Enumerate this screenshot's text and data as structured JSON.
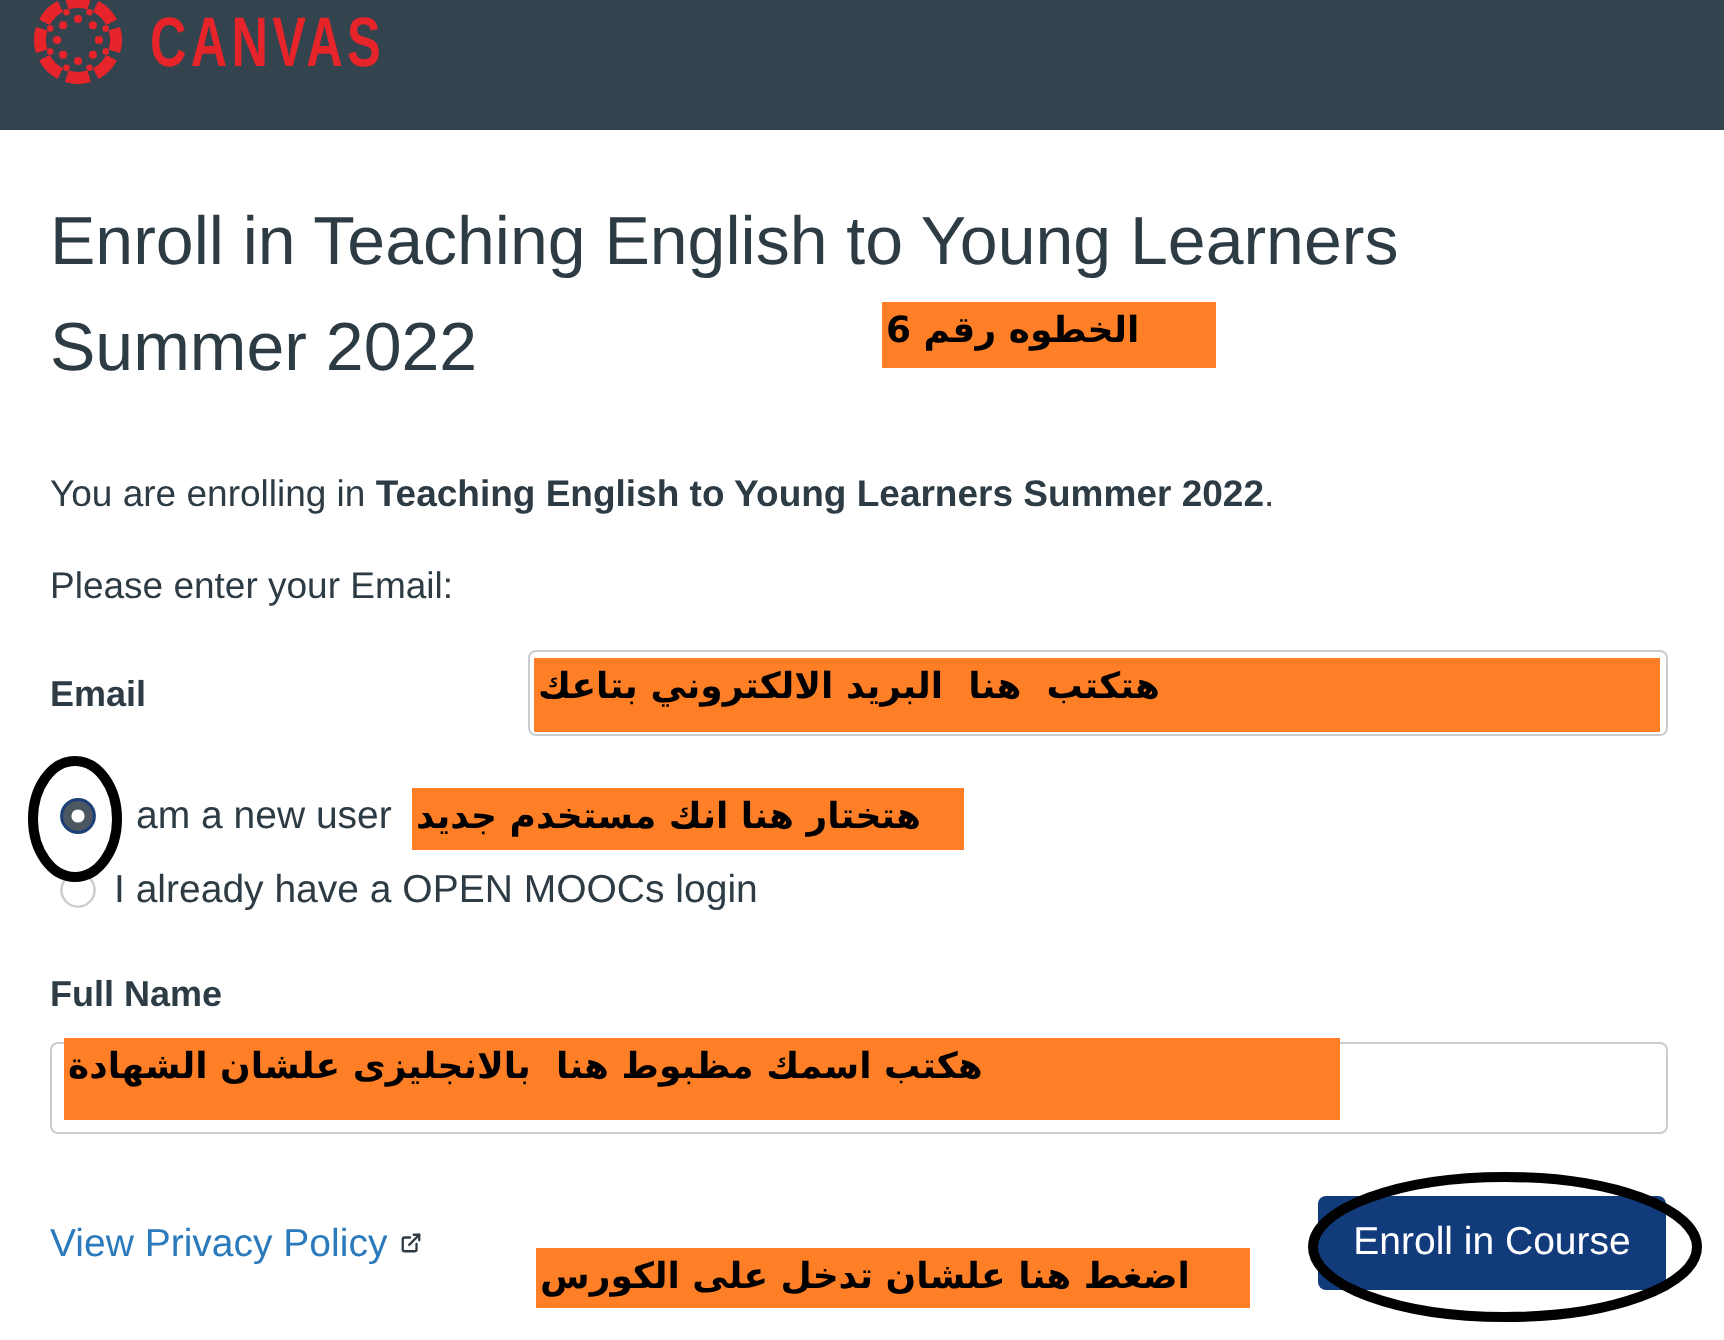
{
  "header": {
    "logo_text": "CANVAS"
  },
  "page": {
    "title_lines": [
      "Enroll in Teaching English to Young Learners",
      "Summer 2022"
    ],
    "title_note": "الخطوه رقم 6",
    "intro": "You are enrolling in **Teaching English to Young Learners Summer 2022**.",
    "prompt": "Please enter your Email:"
  },
  "form": {
    "email": {
      "label": "Email",
      "note": "هتكتب  هنا  البريد الالكتروني بتاعك"
    },
    "user_type": [
      {
        "label": "am a new user",
        "selected": true,
        "circled": true
      },
      {
        "label": "I already have a OPEN MOOCs login",
        "selected": false,
        "circled": false
      }
    ],
    "user_type_note": "هتختار هنا انك مستخدم جديد",
    "full_name": {
      "label": "Full Name",
      "note": "هكتب اسمك مظبوط هنا  بالانجليزى علشان الشهادة"
    }
  },
  "footer": {
    "privacy_link": "View Privacy Policy",
    "submit_button": {
      "label": "Enroll in Course",
      "circled": true
    },
    "note": "اضغط هنا علشان تدخل على الكورس"
  }
}
